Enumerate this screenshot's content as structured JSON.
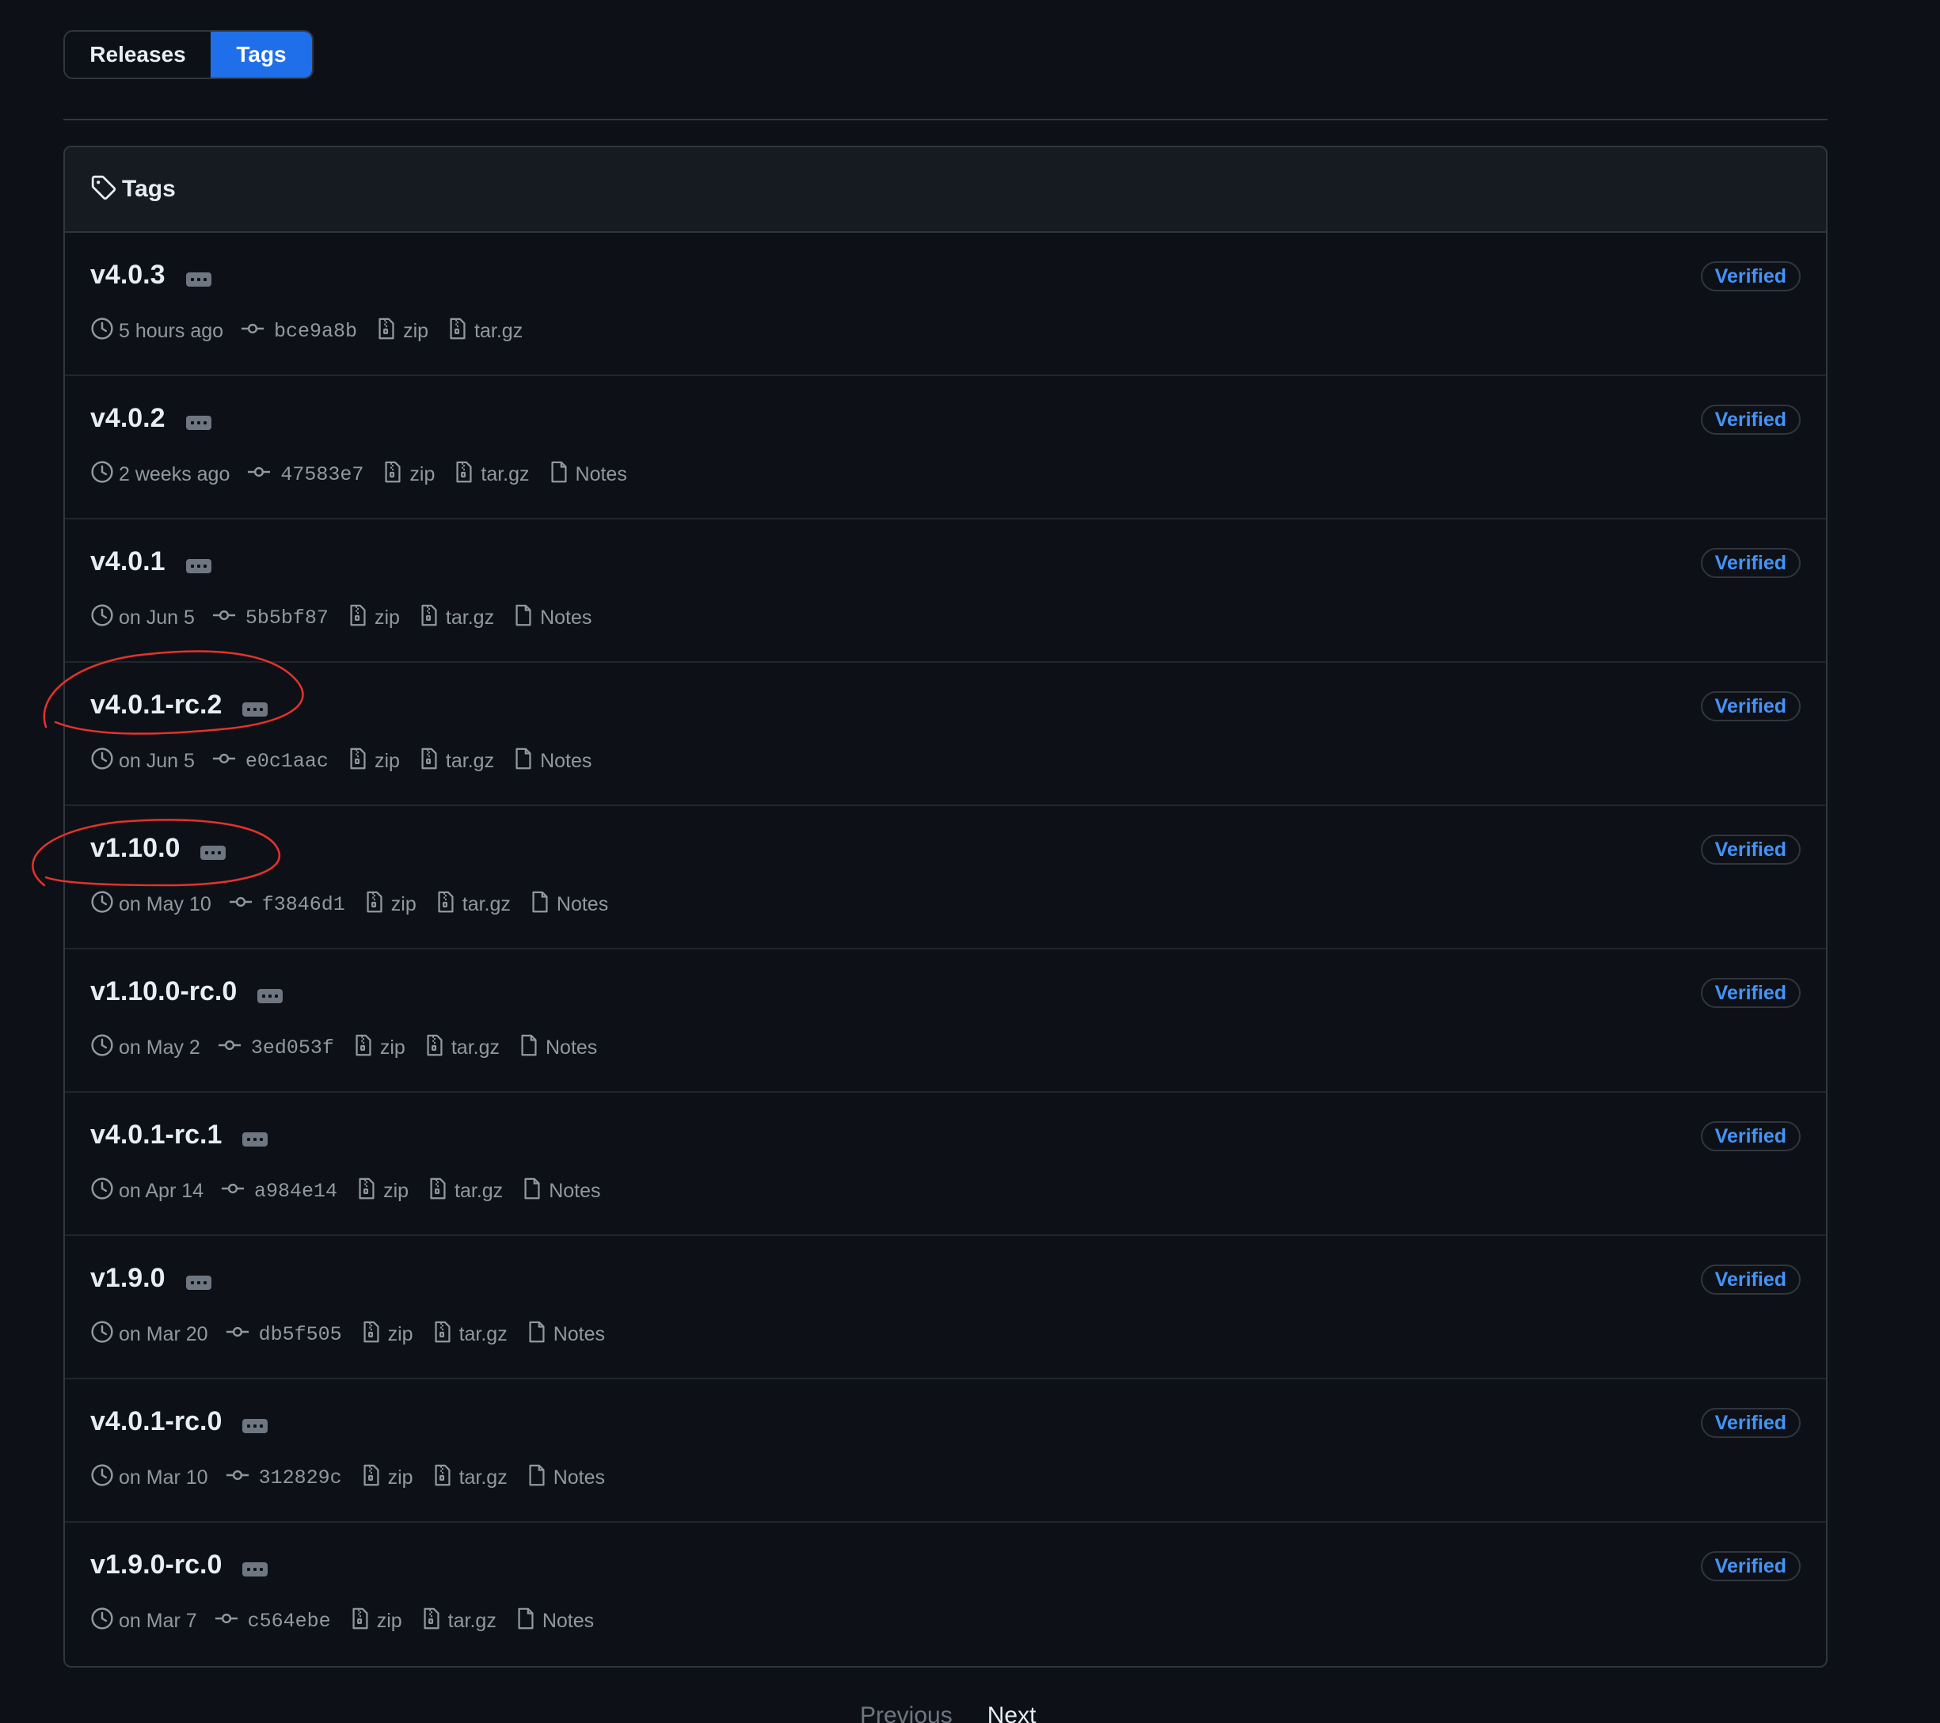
{
  "tabs": {
    "releases_label": "Releases",
    "tags_label": "Tags",
    "active": "Tags"
  },
  "tags_box": {
    "header_title": "Tags",
    "header_icon": "tag-icon"
  },
  "tags": [
    {
      "name": "v4.0.3",
      "time": "5 hours ago",
      "commit": "bce9a8b",
      "zip": "zip",
      "targz": "tar.gz",
      "notes": "",
      "badge": "Verified"
    },
    {
      "name": "v4.0.2",
      "time": "2 weeks ago",
      "commit": "47583e7",
      "zip": "zip",
      "targz": "tar.gz",
      "notes": "Notes",
      "badge": "Verified"
    },
    {
      "name": "v4.0.1",
      "time": "on Jun 5",
      "commit": "5b5bf87",
      "zip": "zip",
      "targz": "tar.gz",
      "notes": "Notes",
      "badge": "Verified"
    },
    {
      "name": "v4.0.1-rc.2",
      "time": "on Jun 5",
      "commit": "e0c1aac",
      "zip": "zip",
      "targz": "tar.gz",
      "notes": "Notes",
      "badge": "Verified"
    },
    {
      "name": "v1.10.0",
      "time": "on May 10",
      "commit": "f3846d1",
      "zip": "zip",
      "targz": "tar.gz",
      "notes": "Notes",
      "badge": "Verified"
    },
    {
      "name": "v1.10.0-rc.0",
      "time": "on May 2",
      "commit": "3ed053f",
      "zip": "zip",
      "targz": "tar.gz",
      "notes": "Notes",
      "badge": "Verified"
    },
    {
      "name": "v4.0.1-rc.1",
      "time": "on Apr 14",
      "commit": "a984e14",
      "zip": "zip",
      "targz": "tar.gz",
      "notes": "Notes",
      "badge": "Verified"
    },
    {
      "name": "v1.9.0",
      "time": "on Mar 20",
      "commit": "db5f505",
      "zip": "zip",
      "targz": "tar.gz",
      "notes": "Notes",
      "badge": "Verified"
    },
    {
      "name": "v4.0.1-rc.0",
      "time": "on Mar 10",
      "commit": "312829c",
      "zip": "zip",
      "targz": "tar.gz",
      "notes": "Notes",
      "badge": "Verified"
    },
    {
      "name": "v1.9.0-rc.0",
      "time": "on Mar 7",
      "commit": "c564ebe",
      "zip": "zip",
      "targz": "tar.gz",
      "notes": "Notes",
      "badge": "Verified"
    }
  ],
  "pagination": {
    "previous_label": "Previous",
    "next_label": "Next"
  },
  "annotations": {
    "circled_tags": [
      "v4.0.1-rc.2",
      "v1.10.0"
    ],
    "color": "#e5322d"
  },
  "colors": {
    "background": "#0d1117",
    "accent": "#1f6feb",
    "verified": "#4493f8",
    "muted": "#9198a1"
  }
}
